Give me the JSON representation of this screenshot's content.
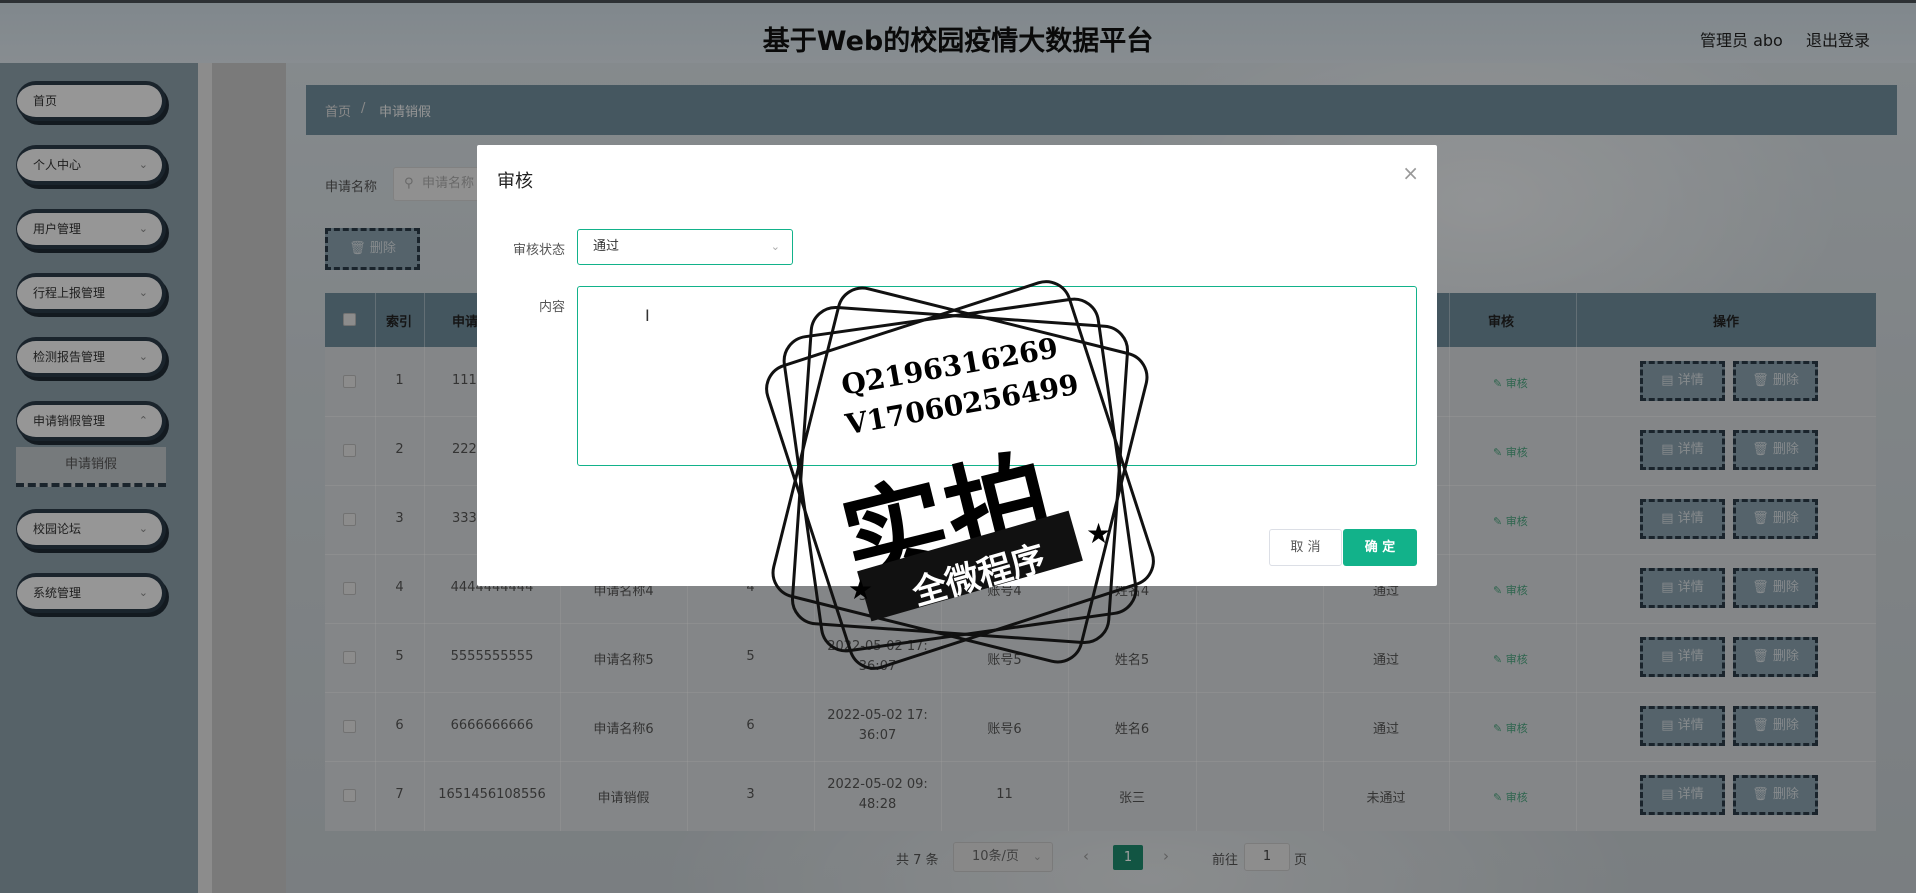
{
  "header": {
    "site_title": "基于Web的校园疫情大数据平台",
    "user": "管理员 abo",
    "logout": "退出登录"
  },
  "sidebar": {
    "items": [
      {
        "label": "首页"
      },
      {
        "label": "个人中心"
      },
      {
        "label": "用户管理"
      },
      {
        "label": "行程上报管理"
      },
      {
        "label": "检测报告管理"
      },
      {
        "label": "申请销假管理"
      },
      {
        "label": "校园论坛"
      },
      {
        "label": "系统管理"
      }
    ],
    "active_sub": "申请销假"
  },
  "breadcrumb": {
    "home": "首页",
    "sep": "/",
    "current": "申请销假"
  },
  "search": {
    "label": "申请名称",
    "placeholder": "申请名称"
  },
  "toolbar": {
    "delete_label": "删除"
  },
  "table": {
    "headers": {
      "index": "索引",
      "col2": "申请",
      "audit": "审核",
      "ops": "操作"
    },
    "rows": [
      {
        "idx": "1",
        "no": "111",
        "name": "",
        "qty": "",
        "time1": "",
        "time2": "",
        "acct": "",
        "uname": "",
        "status": ""
      },
      {
        "idx": "2",
        "no": "222",
        "name": "",
        "qty": "",
        "time1": "",
        "time2": "",
        "acct": "",
        "uname": "",
        "status": ""
      },
      {
        "idx": "3",
        "no": "333",
        "name": "",
        "qty": "",
        "time1": "",
        "time2": "",
        "acct": "",
        "uname": "",
        "status": ""
      },
      {
        "idx": "4",
        "no": "4444444444",
        "name": "申请名称4",
        "qty": "4",
        "time1": "",
        "time2": "36:07",
        "acct": "账号4",
        "uname": "姓名4",
        "status": "通过"
      },
      {
        "idx": "5",
        "no": "5555555555",
        "name": "申请名称5",
        "qty": "5",
        "time1": "2022-05-02 17:",
        "time2": "36:07",
        "acct": "账号5",
        "uname": "姓名5",
        "status": "通过"
      },
      {
        "idx": "6",
        "no": "6666666666",
        "name": "申请名称6",
        "qty": "6",
        "time1": "2022-05-02 17:",
        "time2": "36:07",
        "acct": "账号6",
        "uname": "姓名6",
        "status": "通过"
      },
      {
        "idx": "7",
        "no": "1651456108556",
        "name": "申请销假",
        "qty": "3",
        "time1": "2022-05-02 09:",
        "time2": "48:28",
        "acct": "11",
        "uname": "张三",
        "status": "未通过"
      }
    ],
    "audit_link": "审核",
    "detail_btn": "详情",
    "delete_btn": "删除"
  },
  "pagination": {
    "total": "共 7 条",
    "page_size": "10条/页",
    "current": "1",
    "goto_prefix": "前往",
    "goto_value": "1",
    "goto_suffix": "页"
  },
  "dialog": {
    "title": "审核",
    "status_label": "审核状态",
    "status_value": "通过",
    "content_label": "内容",
    "content_value": "",
    "cancel": "取 消",
    "confirm": "确 定"
  },
  "watermark": {
    "line1": "Q2196316269",
    "line2": "V17060256499",
    "big": "实拍",
    "ribbon": "全微程序"
  },
  "colors": {
    "accent": "#12b28a",
    "header_bar": "#6f8b9a",
    "sidebar_border": "#2b3a48"
  }
}
